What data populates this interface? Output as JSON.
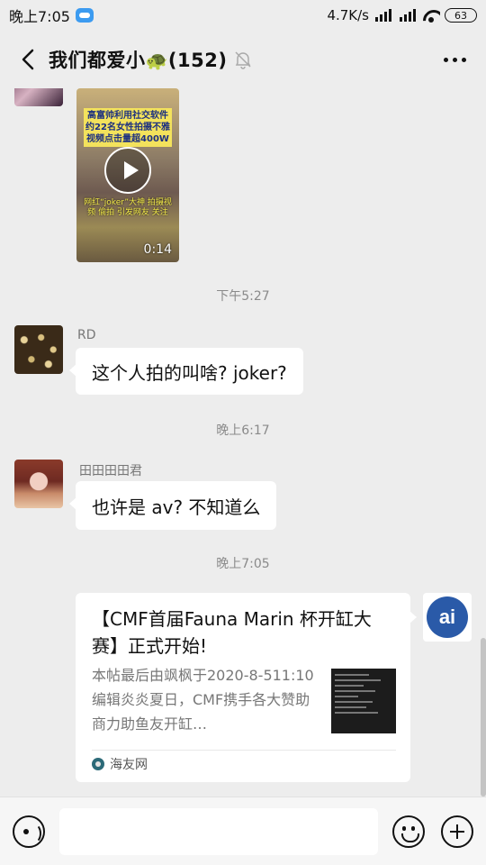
{
  "status_bar": {
    "time": "晚上7:05",
    "speed": "4.7K/s",
    "battery": "63"
  },
  "header": {
    "title": "我们都爱小",
    "title_emoji": "🐢",
    "member_count": "(152)"
  },
  "messages": {
    "video": {
      "caption_top": "高富帅利用社交软件约22名女性拍摄不雅视频点击量超400W",
      "caption_bottom": "网红“joker”大神 拍摄视频 偷拍 引发网友 关注",
      "duration": "0:14"
    },
    "ts1": "下午5:27",
    "rd": {
      "sender": "RD",
      "text": "这个人拍的叫啥? joker?"
    },
    "ts2": "晚上6:17",
    "tian": {
      "sender": "田田田田君",
      "text": "也许是 av? 不知道么"
    },
    "ts3": "晚上7:05",
    "card": {
      "title": "【CMF首届Fauna Marin 杯开缸大赛】正式开始!",
      "desc": "本帖最后由飒枫于2020-8-511:10编辑炎炎夏日，CMF携手各大赞助商力助鱼友开缸…",
      "source": "海友网"
    },
    "card_sender_logo_text": "ai"
  },
  "input": {
    "placeholder": ""
  },
  "colors": {
    "background": "#ededed",
    "bubble": "#ffffff"
  }
}
